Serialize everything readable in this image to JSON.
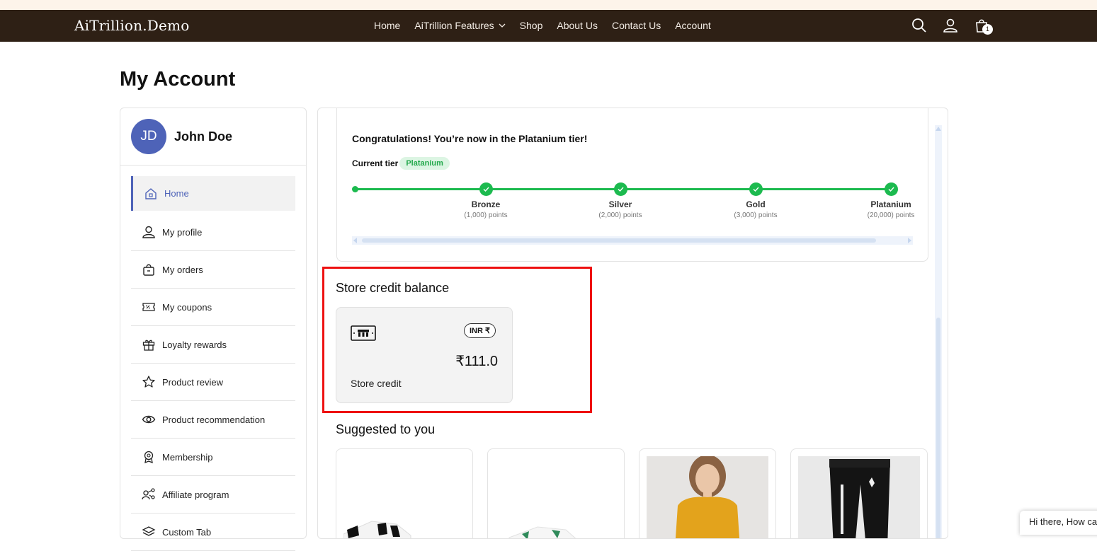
{
  "header": {
    "logo": "AiTrillion.Demo",
    "nav": [
      {
        "label": "Home"
      },
      {
        "label": "AiTrillion Features",
        "has_dropdown": true
      },
      {
        "label": "Shop"
      },
      {
        "label": "About Us"
      },
      {
        "label": "Contact Us"
      },
      {
        "label": "Account"
      }
    ],
    "icons": [
      "search-icon",
      "account-icon",
      "cart-icon"
    ],
    "cart_count": "1"
  },
  "page": {
    "title": "My Account"
  },
  "sidebar": {
    "avatar_initials": "JD",
    "user_name": "John Doe",
    "items": [
      {
        "label": "Home",
        "icon": "home-icon",
        "active": true
      },
      {
        "label": "My profile",
        "icon": "user-icon"
      },
      {
        "label": "My orders",
        "icon": "bag-icon"
      },
      {
        "label": "My coupons",
        "icon": "coupon-icon"
      },
      {
        "label": "Loyalty rewards",
        "icon": "gift-icon"
      },
      {
        "label": "Product review",
        "icon": "star-icon"
      },
      {
        "label": "Product recommendation",
        "icon": "eye-icon"
      },
      {
        "label": "Membership",
        "icon": "medal-icon"
      },
      {
        "label": "Affiliate program",
        "icon": "share-icon"
      },
      {
        "label": "Custom Tab",
        "icon": "layers-icon"
      }
    ]
  },
  "tier": {
    "congrats": "Congratulations! You’re now in the Platanium tier!",
    "current_label": "Current tier",
    "current_badge": "Platanium",
    "milestones": [
      {
        "name": "Bronze",
        "points": "(1,000) points"
      },
      {
        "name": "Silver",
        "points": "(2,000) points"
      },
      {
        "name": "Gold",
        "points": "(3,000) points"
      },
      {
        "name": "Platanium",
        "points": "(20,000) points"
      }
    ]
  },
  "store_credit": {
    "heading": "Store credit balance",
    "currency": "INR ₹",
    "amount": "₹111.0",
    "label": "Store credit"
  },
  "suggested": {
    "heading": "Suggested to you"
  },
  "chat": {
    "text": "Hi there, How can"
  },
  "colors": {
    "header_bg": "#2e2015",
    "accent": "#4e63b8",
    "tier_green": "#1cba4f",
    "highlight": "#ee1111"
  }
}
